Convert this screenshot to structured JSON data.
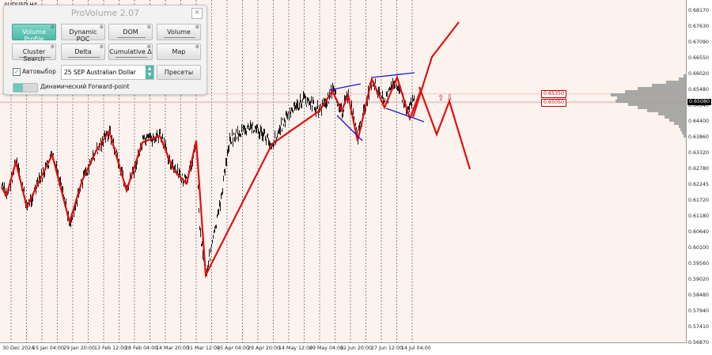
{
  "chart": {
    "symbol": "AUDUSD,H4",
    "current_price": "0.65080",
    "levels": [
      {
        "label": "0.65350",
        "price": 0.6535
      },
      {
        "label": "0.65050",
        "price": 0.6505
      }
    ],
    "colors": {
      "background": "#fdf3ee",
      "candles": "#000000",
      "zigzag": "#e01010",
      "channel": "#1a1ad0",
      "vertical_lines": "#6e6e6e",
      "volume_profile": "#9a9a9a"
    }
  },
  "price_axis": [
    "0.68170",
    "0.67630",
    "0.67090",
    "0.66550",
    "0.66020",
    "0.65480",
    "0.64940",
    "0.64400",
    "0.63860",
    "0.63320",
    "0.62780",
    "0.62245",
    "0.61720",
    "0.61180",
    "0.60640",
    "0.60100",
    "0.59560",
    "0.59020",
    "0.58480",
    "0.57940",
    "0.57410",
    "0.56870"
  ],
  "time_axis": [
    "30 Dec 2024",
    "15 Jan 04:00",
    "29 Jan 20:00",
    "13 Feb 12:00",
    "28 Feb 04:00",
    "14 Mar 20:00",
    "31 Mar 12:00",
    "15 Apr 04:00",
    "29 Apr 20:00",
    "14 May 12:00",
    "29 May 04:00",
    "12 Jun 20:00",
    "27 Jun 12:00",
    "14 Jul 04:00"
  ],
  "panel": {
    "title": "ProVolume 2.07",
    "close": "×",
    "buttons": [
      {
        "label": "Volume Profile",
        "active": true
      },
      {
        "label": "Dynamic POC",
        "active": false
      },
      {
        "label": "DOM",
        "active": false
      },
      {
        "label": "Volume",
        "active": false
      },
      {
        "label": "Cluster Search",
        "active": false
      },
      {
        "label": "Delta",
        "active": false
      },
      {
        "label": "Cumulative Δ",
        "active": false
      },
      {
        "label": "Map",
        "active": false
      }
    ],
    "auto_select_label": "Автовыбор",
    "auto_select_checked": "✓",
    "contract_value": "25 SEP Australian Dollar",
    "presets_button": "Пресеты",
    "forward_point_label": "Динамический Forward-point"
  }
}
